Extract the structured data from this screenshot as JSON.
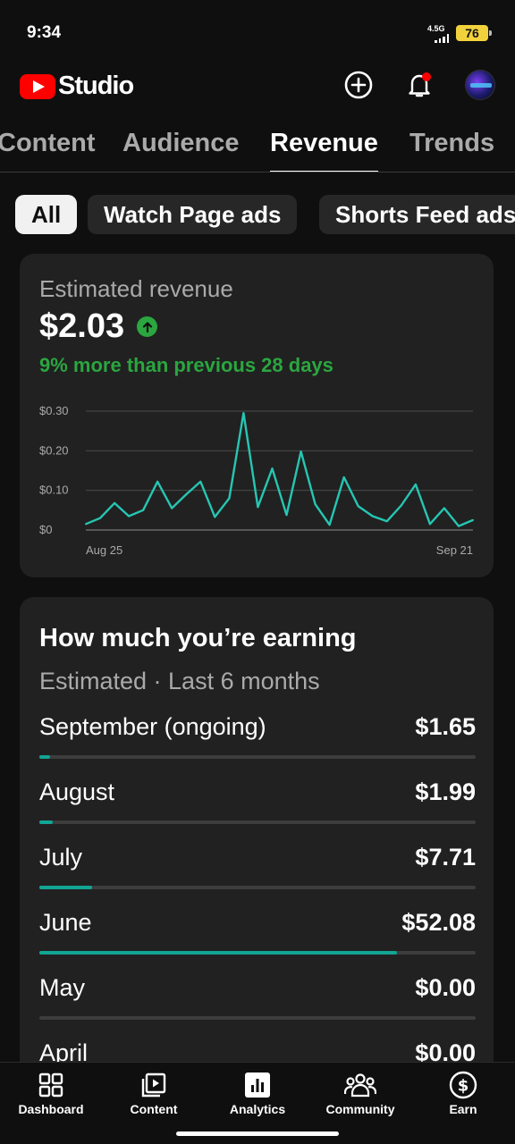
{
  "status_bar": {
    "time": "9:34",
    "network": "4.5G",
    "battery": "76"
  },
  "header": {
    "logo_text": "Studio",
    "icons": [
      "create-icon",
      "notifications-icon"
    ]
  },
  "tabs": [
    {
      "label": "Content",
      "active": false
    },
    {
      "label": "Audience",
      "active": false
    },
    {
      "label": "Revenue",
      "active": true
    },
    {
      "label": "Trends",
      "active": false
    }
  ],
  "chips": [
    {
      "label": "All",
      "active": true
    },
    {
      "label": "Watch Page ads",
      "active": false
    },
    {
      "label": "Shorts Feed ads",
      "active": false
    }
  ],
  "revenue": {
    "title": "Estimated revenue",
    "amount": "$2.03",
    "change": "9% more than previous 28 days",
    "trend": "up"
  },
  "chart_data": {
    "type": "line",
    "x_start_label": "Aug 25",
    "x_end_label": "Sep 21",
    "y_ticks": [
      "$0.30",
      "$0.20",
      "$0.10",
      "$0"
    ],
    "ylim": [
      0,
      0.3
    ],
    "grid": true,
    "color": "#26c6b3",
    "values": [
      0.015,
      0.03,
      0.068,
      0.035,
      0.05,
      0.122,
      0.055,
      0.09,
      0.122,
      0.033,
      0.08,
      0.295,
      0.058,
      0.155,
      0.038,
      0.198,
      0.065,
      0.013,
      0.133,
      0.06,
      0.035,
      0.022,
      0.062,
      0.115,
      0.015,
      0.055,
      0.01,
      0.025
    ]
  },
  "earnings": {
    "title": "How much you’re earning",
    "subtitle": "Estimated · Last 6 months",
    "rows": [
      {
        "month": "September (ongoing)",
        "value": "$1.65",
        "fill": 0.025
      },
      {
        "month": "August",
        "value": "$1.99",
        "fill": 0.03
      },
      {
        "month": "July",
        "value": "$7.71",
        "fill": 0.12
      },
      {
        "month": "June",
        "value": "$52.08",
        "fill": 0.82
      },
      {
        "month": "May",
        "value": "$0.00",
        "fill": 0
      },
      {
        "month": "April",
        "value": "$0.00",
        "fill": 0
      }
    ]
  },
  "bottom_nav": [
    {
      "label": "Dashboard",
      "icon": "dashboard-icon",
      "active": false
    },
    {
      "label": "Content",
      "icon": "content-icon",
      "active": false
    },
    {
      "label": "Analytics",
      "icon": "analytics-icon",
      "active": true
    },
    {
      "label": "Community",
      "icon": "community-icon",
      "active": false
    },
    {
      "label": "Earn",
      "icon": "earn-icon",
      "active": false
    }
  ],
  "colors": {
    "accent": "#26c6b3",
    "positive": "#2ba640",
    "brand": "#ff0000",
    "background": "#0f0f0f",
    "card": "#212121"
  }
}
